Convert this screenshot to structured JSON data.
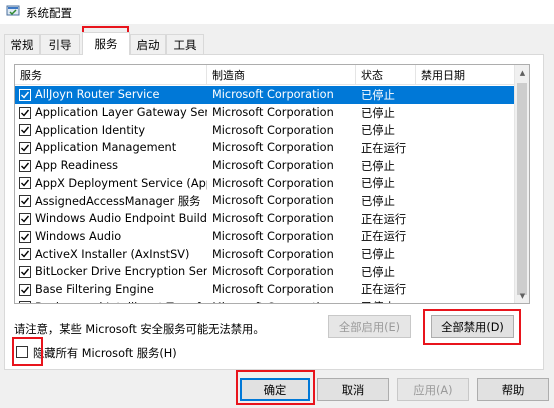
{
  "window": {
    "title": "系统配置"
  },
  "tabs": [
    "常规",
    "引导",
    "服务",
    "启动",
    "工具"
  ],
  "active_tab_index": 2,
  "columns": [
    "服务",
    "制造商",
    "状态",
    "禁用日期"
  ],
  "rows": [
    {
      "name": "AllJoyn Router Service",
      "manufacturer": "Microsoft Corporation",
      "status": "已停止",
      "disabled_date": "",
      "checked": true,
      "selected": true
    },
    {
      "name": "Application Layer Gateway Service",
      "manufacturer": "Microsoft Corporation",
      "status": "已停止",
      "disabled_date": "",
      "checked": true
    },
    {
      "name": "Application Identity",
      "manufacturer": "Microsoft Corporation",
      "status": "已停止",
      "disabled_date": "",
      "checked": true
    },
    {
      "name": "Application Management",
      "manufacturer": "Microsoft Corporation",
      "status": "正在运行",
      "disabled_date": "",
      "checked": true
    },
    {
      "name": "App Readiness",
      "manufacturer": "Microsoft Corporation",
      "status": "已停止",
      "disabled_date": "",
      "checked": true
    },
    {
      "name": "AppX Deployment Service (AppX...",
      "manufacturer": "Microsoft Corporation",
      "status": "已停止",
      "disabled_date": "",
      "checked": true
    },
    {
      "name": "AssignedAccessManager 服务",
      "manufacturer": "Microsoft Corporation",
      "status": "已停止",
      "disabled_date": "",
      "checked": true
    },
    {
      "name": "Windows Audio Endpoint Builder",
      "manufacturer": "Microsoft Corporation",
      "status": "正在运行",
      "disabled_date": "",
      "checked": true
    },
    {
      "name": "Windows Audio",
      "manufacturer": "Microsoft Corporation",
      "status": "正在运行",
      "disabled_date": "",
      "checked": true
    },
    {
      "name": "ActiveX Installer (AxInstSV)",
      "manufacturer": "Microsoft Corporation",
      "status": "已停止",
      "disabled_date": "",
      "checked": true
    },
    {
      "name": "BitLocker Drive Encryption Service",
      "manufacturer": "Microsoft Corporation",
      "status": "已停止",
      "disabled_date": "",
      "checked": true
    },
    {
      "name": "Base Filtering Engine",
      "manufacturer": "Microsoft Corporation",
      "status": "正在运行",
      "disabled_date": "",
      "checked": true
    },
    {
      "name": "Background Intelligent Transfer...",
      "manufacturer": "Microsoft Corporation",
      "status": "已停止",
      "disabled_date": "",
      "checked": true
    }
  ],
  "note": "请注意，某些 Microsoft 安全服务可能无法禁用。",
  "buttons": {
    "enable_all": "全部启用(E)",
    "disable_all": "全部禁用(D)",
    "ok": "确定",
    "cancel": "取消",
    "apply": "应用(A)",
    "help": "帮助"
  },
  "hide_ms_label": "隐藏所有 Microsoft 服务(H)",
  "hide_ms_checked": false,
  "colors": {
    "selection": "#0078d7",
    "highlight_box": "#e8141c"
  }
}
